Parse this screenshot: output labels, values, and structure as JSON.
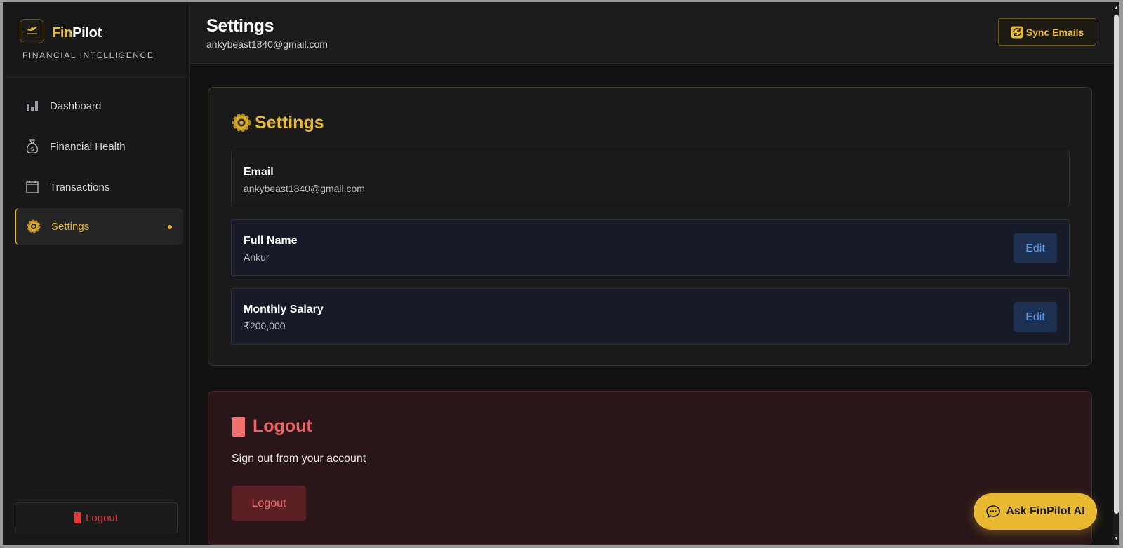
{
  "brand": {
    "fin": "Fin",
    "pilot": "Pilot",
    "tagline": "FINANCIAL INTELLIGENCE"
  },
  "sidebar": {
    "items": [
      {
        "label": "Dashboard",
        "icon": "bar-chart-icon"
      },
      {
        "label": "Financial Health",
        "icon": "money-bag-icon"
      },
      {
        "label": "Transactions",
        "icon": "calendar-icon"
      },
      {
        "label": "Settings",
        "icon": "gear-icon",
        "active": true
      }
    ],
    "logout_label": "Logout"
  },
  "header": {
    "title": "Settings",
    "email": "ankybeast1840@gmail.com",
    "sync_label": "Sync Emails"
  },
  "settings_card": {
    "title": "Settings",
    "email_label": "Email",
    "email_value": "ankybeast1840@gmail.com",
    "name_label": "Full Name",
    "name_value": "Ankur",
    "salary_label": "Monthly Salary",
    "salary_value": "₹200,000",
    "edit_label": "Edit"
  },
  "logout_card": {
    "title": "Logout",
    "description": "Sign out from your account",
    "button_label": "Logout"
  },
  "ask_ai_label": "Ask FinPilot AI",
  "colors": {
    "accent": "#e8b931",
    "danger": "#ef6363",
    "link": "#5a9cf0"
  }
}
